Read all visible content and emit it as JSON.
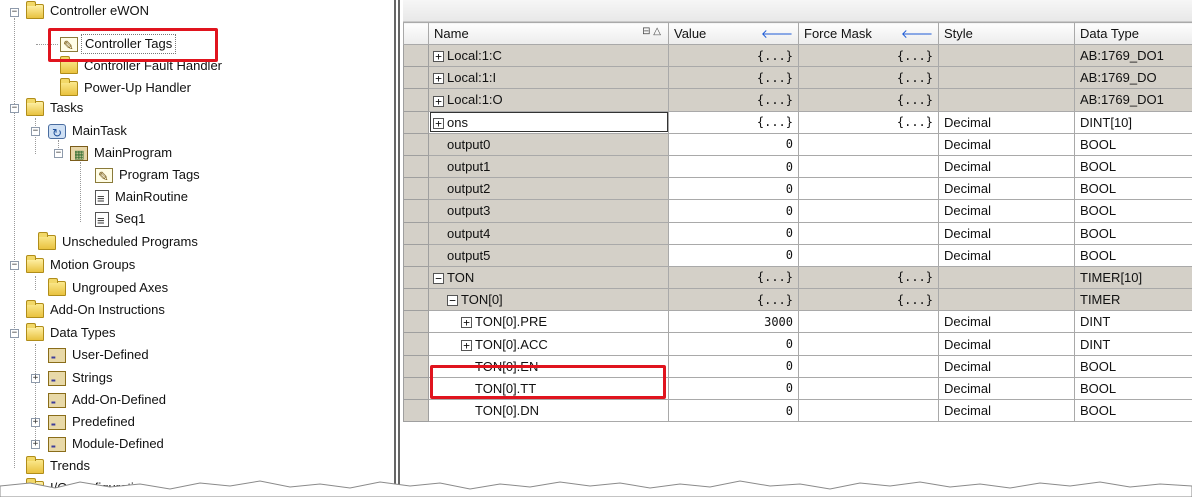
{
  "tree": {
    "items": [
      {
        "label": "Controller eWON",
        "icon": "folder-open-icon"
      },
      {
        "label": "Controller Tags",
        "icon": "tags-icon"
      },
      {
        "label": "Controller Fault Handler",
        "icon": "folder-icon"
      },
      {
        "label": "Power-Up Handler",
        "icon": "folder-icon"
      },
      {
        "label": "Tasks",
        "icon": "folder-open-icon"
      },
      {
        "label": "MainTask",
        "icon": "task-icon"
      },
      {
        "label": "MainProgram",
        "icon": "program-icon"
      },
      {
        "label": "Program Tags",
        "icon": "tags-icon"
      },
      {
        "label": "MainRoutine",
        "icon": "routine-icon"
      },
      {
        "label": "Seq1",
        "icon": "routine-icon"
      },
      {
        "label": "Unscheduled Programs",
        "icon": "folder-icon"
      },
      {
        "label": "Motion Groups",
        "icon": "folder-open-icon"
      },
      {
        "label": "Ungrouped Axes",
        "icon": "folder-icon"
      },
      {
        "label": "Add-On Instructions",
        "icon": "folder-icon"
      },
      {
        "label": "Data Types",
        "icon": "folder-open-icon"
      },
      {
        "label": "User-Defined",
        "icon": "datatype-icon"
      },
      {
        "label": "Strings",
        "icon": "datatype-icon"
      },
      {
        "label": "Add-On-Defined",
        "icon": "datatype-icon"
      },
      {
        "label": "Predefined",
        "icon": "datatype-icon"
      },
      {
        "label": "Module-Defined",
        "icon": "datatype-icon"
      },
      {
        "label": "Trends",
        "icon": "folder-icon"
      },
      {
        "label": "I/O Configuration",
        "icon": "folder-icon"
      }
    ]
  },
  "grid": {
    "columns": {
      "name": "Name",
      "value": "Value",
      "force_mask": "Force Mask",
      "style": "Style",
      "data_type": "Data Type"
    },
    "rows": [
      {
        "name": "Local:1:C",
        "value": "{...}",
        "force": "{...}",
        "style": "",
        "type": "AB:1769_DO1"
      },
      {
        "name": "Local:1:I",
        "value": "{...}",
        "force": "{...}",
        "style": "",
        "type": "AB:1769_DO"
      },
      {
        "name": "Local:1:O",
        "value": "{...}",
        "force": "{...}",
        "style": "",
        "type": "AB:1769_DO1"
      },
      {
        "name": "ons",
        "value": "{...}",
        "force": "{...}",
        "style": "Decimal",
        "type": "DINT[10]"
      },
      {
        "name": "output0",
        "value": "0",
        "force": "",
        "style": "Decimal",
        "type": "BOOL"
      },
      {
        "name": "output1",
        "value": "0",
        "force": "",
        "style": "Decimal",
        "type": "BOOL"
      },
      {
        "name": "output2",
        "value": "0",
        "force": "",
        "style": "Decimal",
        "type": "BOOL"
      },
      {
        "name": "output3",
        "value": "0",
        "force": "",
        "style": "Decimal",
        "type": "BOOL"
      },
      {
        "name": "output4",
        "value": "0",
        "force": "",
        "style": "Decimal",
        "type": "BOOL"
      },
      {
        "name": "output5",
        "value": "0",
        "force": "",
        "style": "Decimal",
        "type": "BOOL"
      },
      {
        "name": "TON",
        "value": "{...}",
        "force": "{...}",
        "style": "",
        "type": "TIMER[10]"
      },
      {
        "name": "TON[0]",
        "value": "{...}",
        "force": "{...}",
        "style": "",
        "type": "TIMER"
      },
      {
        "name": "TON[0].PRE",
        "value": "3000",
        "force": "",
        "style": "Decimal",
        "type": "DINT"
      },
      {
        "name": "TON[0].ACC",
        "value": "0",
        "force": "",
        "style": "Decimal",
        "type": "DINT"
      },
      {
        "name": "TON[0].EN",
        "value": "0",
        "force": "",
        "style": "Decimal",
        "type": "BOOL"
      },
      {
        "name": "TON[0].TT",
        "value": "0",
        "force": "",
        "style": "Decimal",
        "type": "BOOL"
      },
      {
        "name": "TON[0].DN",
        "value": "0",
        "force": "",
        "style": "Decimal",
        "type": "BOOL"
      }
    ]
  },
  "colors": {
    "highlight": "#e0141e",
    "struct_row": "#d4d0c8",
    "arrow": "#1e5bd6"
  }
}
